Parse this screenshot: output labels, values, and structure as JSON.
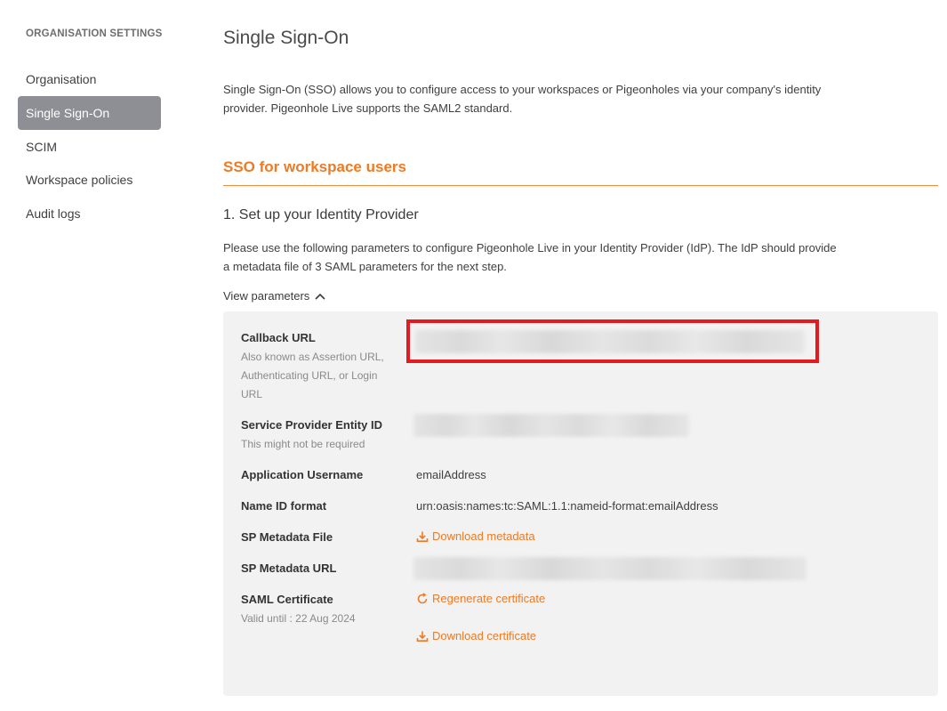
{
  "sidebar": {
    "heading": "ORGANISATION SETTINGS",
    "items": [
      {
        "label": "Organisation",
        "active": false
      },
      {
        "label": "Single Sign-On",
        "active": true
      },
      {
        "label": "SCIM",
        "active": false
      },
      {
        "label": "Workspace policies",
        "active": false
      },
      {
        "label": "Audit logs",
        "active": false
      }
    ]
  },
  "main": {
    "title": "Single Sign-On",
    "intro": "Single Sign-On (SSO) allows you to configure access to your workspaces or Pigeonholes via your company's identity provider. Pigeonhole Live supports the SAML2 standard.",
    "section_title": "SSO for workspace users",
    "step_title": "1. Set up your Identity Provider",
    "step_desc": "Please use the following parameters to configure Pigeonhole Live in your Identity Provider (IdP). The IdP should provide a metadata file of 3 SAML parameters for the next step.",
    "view_params_label": "View parameters",
    "params": {
      "callback_url": {
        "label": "Callback URL",
        "sub": "Also known as Assertion URL, Authenticating URL, or Login URL"
      },
      "sp_entity_id": {
        "label": "Service Provider Entity ID",
        "sub": "This might not be required"
      },
      "app_username": {
        "label": "Application Username",
        "value": "emailAddress"
      },
      "name_id_format": {
        "label": "Name ID format",
        "value": "urn:oasis:names:tc:SAML:1.1:nameid-format:emailAddress"
      },
      "sp_metadata_file": {
        "label": "SP Metadata File",
        "link": "Download metadata"
      },
      "sp_metadata_url": {
        "label": "SP Metadata URL"
      },
      "saml_certificate": {
        "label": "SAML Certificate",
        "sub": "Valid until : 22 Aug 2024",
        "regenerate_link": "Regenerate certificate",
        "download_link": "Download certificate"
      }
    }
  },
  "colors": {
    "accent": "#ee7a23",
    "active_nav_bg": "#8e8f95",
    "panel_bg": "#f2f2f2",
    "highlight": "#e21b23"
  },
  "icons": {
    "view_params_toggle": "chevron-up-icon",
    "download": "download-icon",
    "regenerate": "refresh-icon"
  }
}
